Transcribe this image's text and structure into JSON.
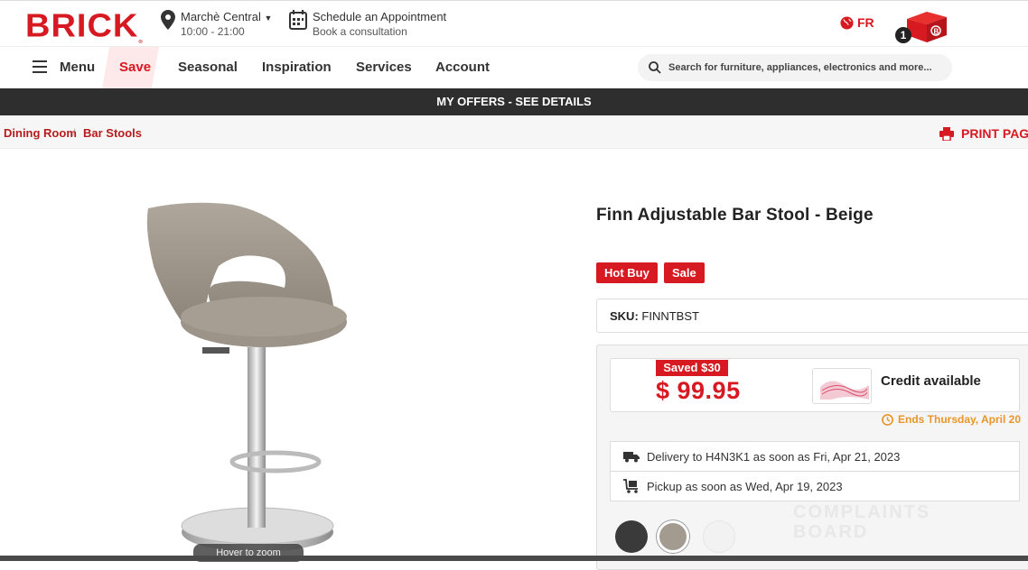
{
  "header": {
    "logo": "BRICK",
    "store": {
      "name": "Marchè Central",
      "hours": "10:00 - 21:00"
    },
    "appointment": {
      "title": "Schedule an Appointment",
      "subtitle": "Book a consultation"
    },
    "language": "FR",
    "cart_count": "1",
    "brand_color": "#d71921"
  },
  "nav": {
    "menu_label": "Menu",
    "items": [
      "Save",
      "Seasonal",
      "Inspiration",
      "Services",
      "Account"
    ],
    "search_placeholder": "Search for furniture, appliances, electronics and more..."
  },
  "offers_bar": "MY OFFERS - SEE DETAILS",
  "breadcrumb": [
    "Dining Room",
    "Bar Stools"
  ],
  "print_label": "PRINT PAGE",
  "product": {
    "title": "Finn Adjustable Bar Stool - Beige",
    "badges": [
      "Hot Buy",
      "Sale"
    ],
    "sku_label": "SKU:",
    "sku_value": "FINNTBST",
    "saved": "Saved $30",
    "price": "$ 99.95",
    "credit": "Credit available",
    "ends": "Ends Thursday, April 20",
    "delivery": "Delivery to H4N3K1 as soon as Fri, Apr 21, 2023",
    "pickup": "Pickup as soon as Wed, Apr 19, 2023",
    "hover_zoom": "Hover to zoom",
    "swatch_colors": [
      "#3a3a3a",
      "#a49b90",
      "#f2f2f2"
    ]
  },
  "watermark": [
    "COMPLAINTS",
    "BOARD"
  ]
}
